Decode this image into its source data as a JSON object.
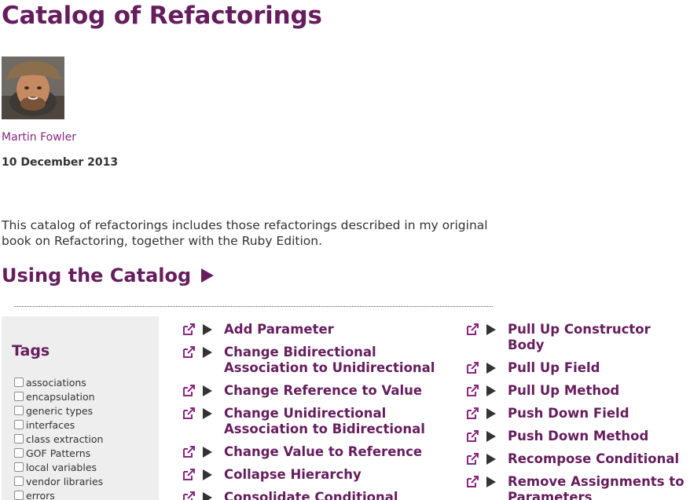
{
  "page": {
    "title": "Catalog of Refactorings",
    "author": "Martin Fowler",
    "date": "10 December 2013",
    "intro": "This catalog of refactorings includes those refactorings described in my original book on Refactoring, together with the Ruby Edition.",
    "section_heading": "Using the Catalog"
  },
  "tags": {
    "title": "Tags",
    "items": [
      "associations",
      "encapsulation",
      "generic types",
      "interfaces",
      "class extraction",
      "GOF Patterns",
      "local variables",
      "vendor libraries",
      "errors"
    ]
  },
  "refactorings": {
    "column1": [
      "Add Parameter",
      "Change Bidirectional Association to Unidirectional",
      "Change Reference to Value",
      "Change Unidirectional Association to Bidirectional",
      "Change Value to Reference",
      "Collapse Hierarchy",
      "Consolidate Conditional"
    ],
    "column2": [
      "Pull Up Constructor Body",
      "Pull Up Field",
      "Pull Up Method",
      "Push Down Field",
      "Push Down Method",
      "Recompose Conditional",
      "Remove Assignments to Parameters"
    ]
  },
  "icons": {
    "external_link": "external-link-icon",
    "expand": "play-triangle-icon",
    "section_expand": "play-triangle-icon"
  },
  "colors": {
    "brand": "#661d5e",
    "link": "#8a2582",
    "text": "#333333",
    "panel_bg": "#eeeeee"
  }
}
